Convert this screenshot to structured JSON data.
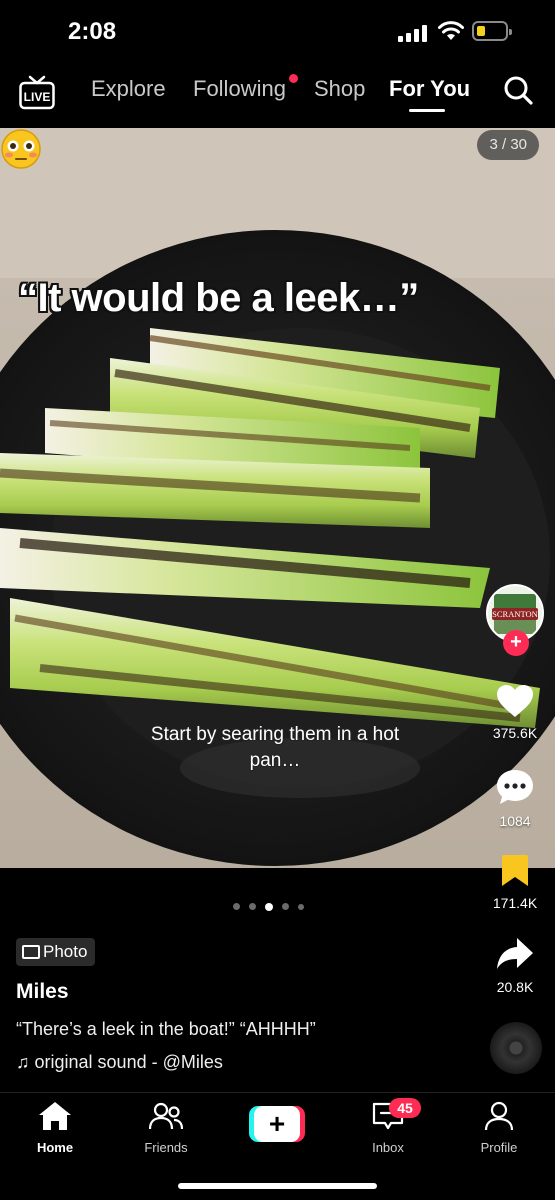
{
  "status_bar": {
    "time": "2:08"
  },
  "top_nav": {
    "live_label": "LIVE",
    "tabs": [
      {
        "label": "Explore"
      },
      {
        "label": "Following"
      },
      {
        "label": "Shop"
      },
      {
        "label": "For You"
      }
    ],
    "active_tab": "For You"
  },
  "photo": {
    "counter": "3 / 30",
    "overlay_title": "“It would be a leek…”",
    "overlay_emoji": "flushed-face",
    "overlay_caption": "Start by searing them in a hot pan…",
    "avatar_text": "SCRANTON"
  },
  "actions": {
    "likes": "375.6K",
    "comments": "1084",
    "bookmarks": "171.4K",
    "shares": "20.8K"
  },
  "pager": {
    "total_visible": 5,
    "active_index": 2
  },
  "post": {
    "type_badge": "Photo",
    "author": "Miles",
    "description": "“There’s a leek in the boat!” “AHHHH”",
    "sound_label": "original sound - @Miles"
  },
  "bottom_nav": {
    "home": "Home",
    "friends": "Friends",
    "create": "+",
    "inbox": "Inbox",
    "inbox_badge": "45",
    "profile": "Profile"
  },
  "colors": {
    "accent": "#fe2c55",
    "bookmark": "#f9c51f",
    "background": "#000000"
  }
}
